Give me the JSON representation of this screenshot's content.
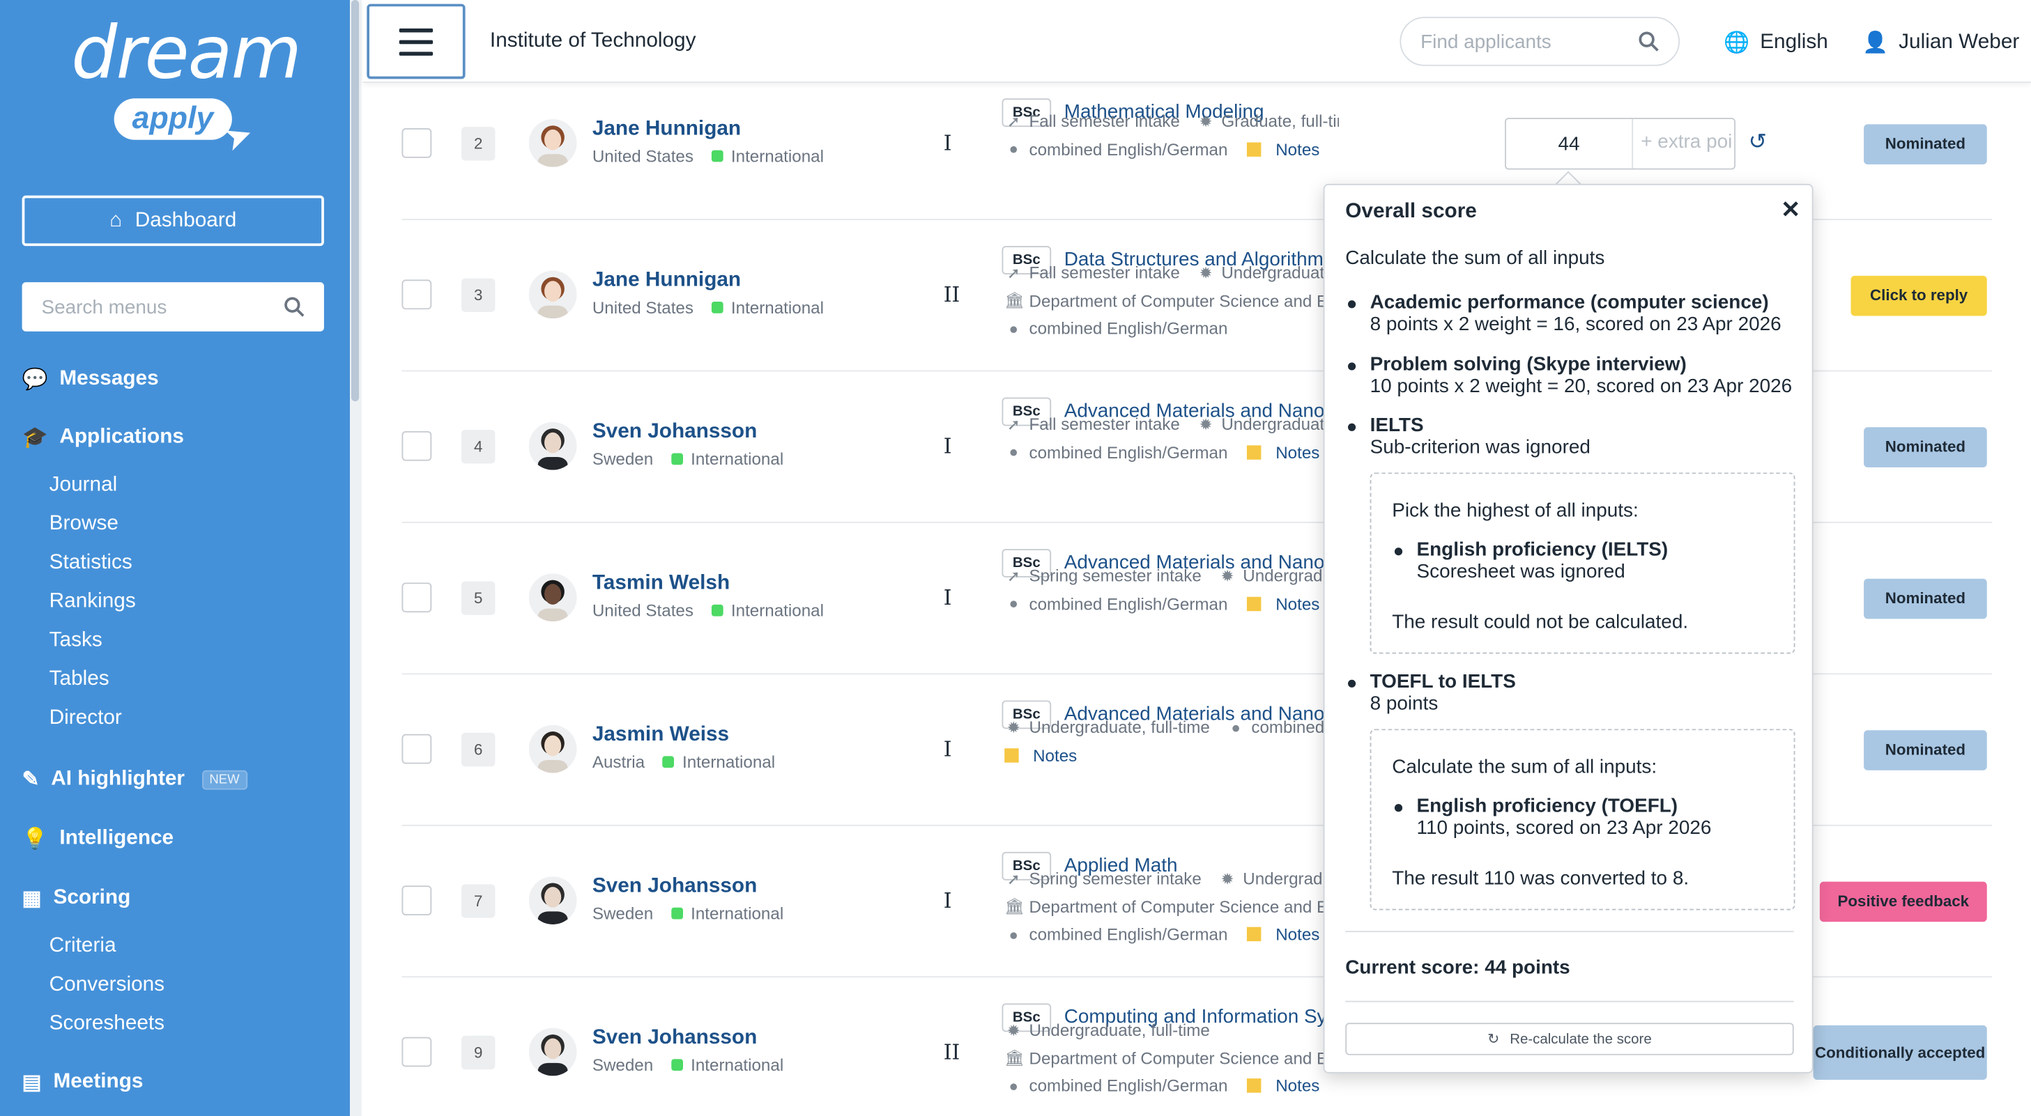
{
  "brand": {
    "logo_main": "dream",
    "logo_sub": "apply"
  },
  "sidebar": {
    "dashboard": "Dashboard",
    "search_placeholder": "Search menus",
    "messages": "Messages",
    "applications": "Applications",
    "applications_sub": [
      "Journal",
      "Browse",
      "Statistics",
      "Rankings",
      "Tasks",
      "Tables",
      "Director"
    ],
    "ai": "AI highlighter",
    "ai_badge": "NEW",
    "intelligence": "Intelligence",
    "scoring": "Scoring",
    "scoring_sub": [
      "Criteria",
      "Conversions",
      "Scoresheets"
    ],
    "meetings": "Meetings"
  },
  "topbar": {
    "institution": "Institute of Technology",
    "find_placeholder": "Find applicants",
    "language": "English",
    "user": "Julian Weber"
  },
  "rows": [
    {
      "num": "2",
      "name": "Jane Hunnigan",
      "country": "United States",
      "type": "International",
      "roman": "I",
      "degree": "BSc",
      "program": "Mathematical Modeling",
      "intake": "Fall semester intake",
      "level": "Graduate, full-time",
      "lang": "combined English/German",
      "notes": "Notes",
      "status": "Nominated"
    },
    {
      "num": "3",
      "name": "Jane Hunnigan",
      "country": "United States",
      "type": "International",
      "roman": "II",
      "degree": "BSc",
      "program": "Data Structures and Algorithms",
      "intake": "Fall semester intake",
      "level": "Undergraduate, full-time",
      "dept": "Department of Computer Science and Engineering",
      "lang": "combined English/German",
      "status": "Click to reply"
    },
    {
      "num": "4",
      "name": "Sven Johansson",
      "country": "Sweden",
      "type": "International",
      "roman": "I",
      "degree": "BSc",
      "program": "Advanced Materials and Nanotechnology",
      "intake": "Fall semester intake",
      "level": "Undergraduate, full-time",
      "lang": "combined English/German",
      "notes": "Notes",
      "status": "Nominated"
    },
    {
      "num": "5",
      "name": "Tasmin Welsh",
      "country": "United States",
      "type": "International",
      "roman": "I",
      "degree": "BSc",
      "program": "Advanced Materials and Nanotechnology",
      "intake": "Spring semester intake",
      "level": "Undergraduate, full-time",
      "lang": "combined English/German",
      "notes": "Notes",
      "status": "Nominated"
    },
    {
      "num": "6",
      "name": "Jasmin Weiss",
      "country": "Austria",
      "type": "International",
      "roman": "I",
      "degree": "BSc",
      "program": "Advanced Materials and Nanotechnology",
      "level": "Undergraduate, full-time",
      "lang": "combined English/German",
      "notes": "Notes",
      "status": "Nominated"
    },
    {
      "num": "7",
      "name": "Sven Johansson",
      "country": "Sweden",
      "type": "International",
      "roman": "I",
      "degree": "BSc",
      "program": "Applied Math",
      "intake": "Spring semester intake",
      "level": "Undergraduate, full-time",
      "dept": "Department of Computer Science and Engineering",
      "lang": "combined English/German",
      "notes": "Notes",
      "status": "Positive feedback"
    },
    {
      "num": "9",
      "name": "Sven Johansson",
      "country": "Sweden",
      "type": "International",
      "roman": "II",
      "degree": "BSc",
      "program": "Computing and Information Systems",
      "level": "Undergraduate, full-time",
      "dept": "Department of Computer Science and Engineering",
      "lang": "combined English/German",
      "notes": "Notes",
      "status": "Conditionally accepted"
    }
  ],
  "score": {
    "value": "44",
    "extra_placeholder": "extra points"
  },
  "popover": {
    "title": "Overall score",
    "desc": "Calculate the sum of all inputs",
    "items": [
      {
        "title": "Academic performance (computer science)",
        "sub": "8 points x 2 weight = 16, scored on 23 Apr 2026"
      },
      {
        "title": "Problem solving (Skype interview)",
        "sub": "10 points x 2 weight = 20, scored on 23 Apr 2026"
      },
      {
        "title": "IELTS",
        "sub": "Sub-criterion was ignored"
      },
      {
        "title": "TOEFL to IELTS",
        "sub": "8 points"
      }
    ],
    "box1": {
      "head": "Pick the highest of all inputs:",
      "item_title": "English proficiency (IELTS)",
      "item_sub": "Scoresheet was ignored",
      "result": "The result could not be calculated."
    },
    "box2": {
      "head": "Calculate the sum of all inputs:",
      "item_title": "English proficiency (TOEFL)",
      "item_sub": "110 points, scored on 23 Apr 2026",
      "result": "The result 110 was converted to 8."
    },
    "current": "Current score: 44 points",
    "recalc": "Re-calculate the score"
  }
}
